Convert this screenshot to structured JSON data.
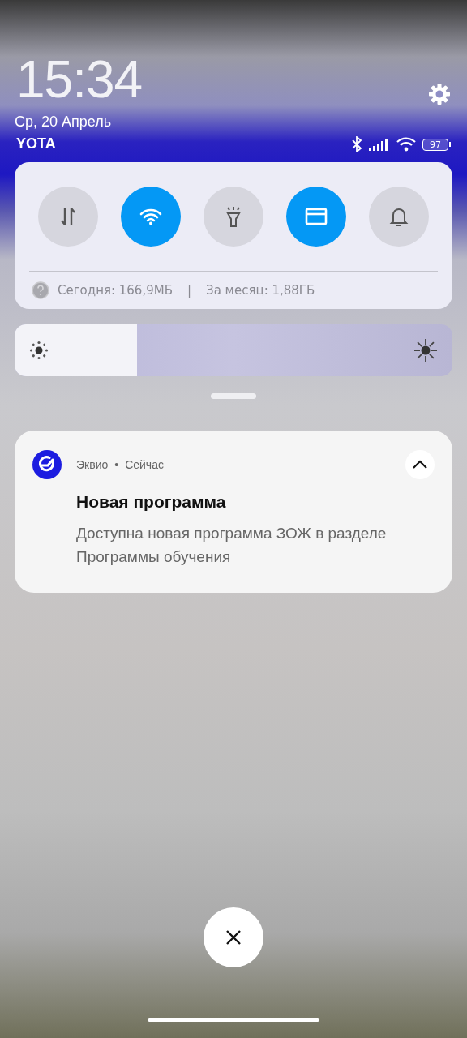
{
  "header": {
    "time": "15:34",
    "date": "Ср, 20 Апрель",
    "carrier": "YOTA",
    "battery": "97"
  },
  "toggles": [
    {
      "kind": "data",
      "on": false
    },
    {
      "kind": "wifi",
      "on": true
    },
    {
      "kind": "flashlight",
      "on": false
    },
    {
      "kind": "card",
      "on": true
    },
    {
      "kind": "bell",
      "on": false
    }
  ],
  "data_usage": {
    "today": "Сегодня: 166,9МБ",
    "separator": "|",
    "month": "За месяц: 1,88ГБ"
  },
  "brightness": {
    "level": 0.28
  },
  "notification": {
    "app": "Эквио",
    "dot": "•",
    "time": "Сейчас",
    "title": "Новая программа",
    "body": "Доступна новая программа ЗОЖ в разделе Программы обучения",
    "expanded": true
  }
}
